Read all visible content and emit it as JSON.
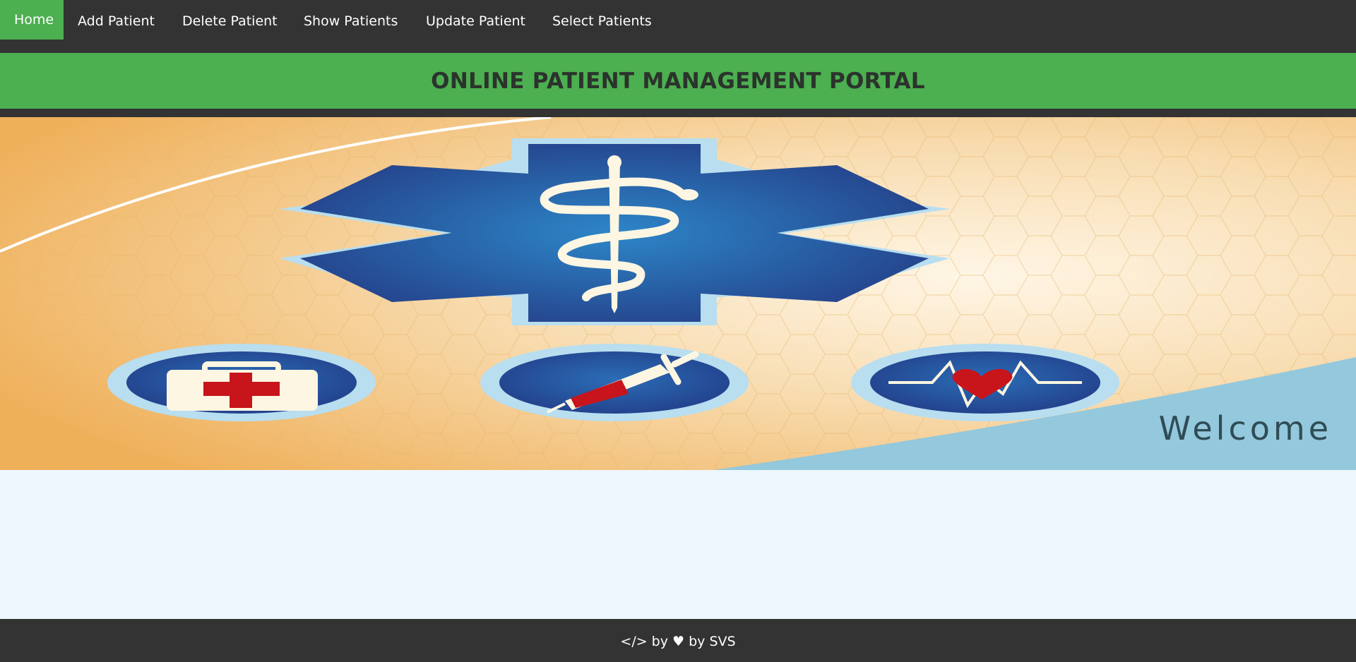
{
  "nav": {
    "items": [
      {
        "label": "Home",
        "active": true
      },
      {
        "label": "Add Patient",
        "active": false
      },
      {
        "label": "Delete Patient",
        "active": false
      },
      {
        "label": "Show Patients",
        "active": false
      },
      {
        "label": "Update Patient",
        "active": false
      },
      {
        "label": "Select Patients",
        "active": false
      }
    ]
  },
  "header": {
    "title": "ONLINE PATIENT MANAGEMENT PORTAL"
  },
  "hero": {
    "welcome": "Welcome",
    "icons": [
      "star-of-life-icon",
      "first-aid-kit-icon",
      "syringe-icon",
      "heartbeat-icon"
    ]
  },
  "footer": {
    "text": "</> by ♥ by SVS"
  },
  "colors": {
    "nav_bg": "#333333",
    "accent": "#4caf50",
    "content_bg": "#eef7fd",
    "hero_orange": "#f0b45c",
    "hero_blue": "#2a4a95",
    "hero_teal": "#94c8dc"
  }
}
